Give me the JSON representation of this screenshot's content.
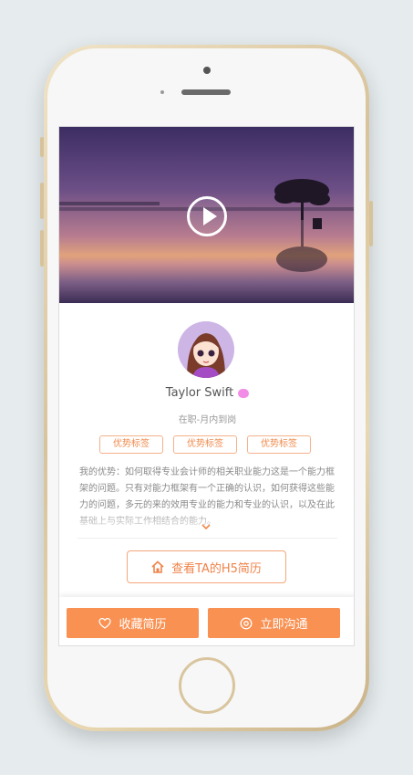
{
  "video": {
    "play_icon": "play-icon"
  },
  "profile": {
    "name": "Taylor Swift",
    "status": "在职-月内到岗",
    "tags": [
      "优势标签",
      "优势标签",
      "优势标签"
    ],
    "intro": "我的优势：如何取得专业会计师的相关职业能力这是一个能力框架的问题。只有对能力框架有一个正确的认识，如何获得这些能力的问题，多元的来的效用专业的能力和专业的认识，以及在此基础上与实际工作相结合的能力。"
  },
  "actions": {
    "h5_resume": "查看TA的H5简历",
    "favorite": "收藏简历",
    "contact": "立即沟通"
  },
  "colors": {
    "accent": "#f99153",
    "tag_border": "#f5b18b"
  }
}
